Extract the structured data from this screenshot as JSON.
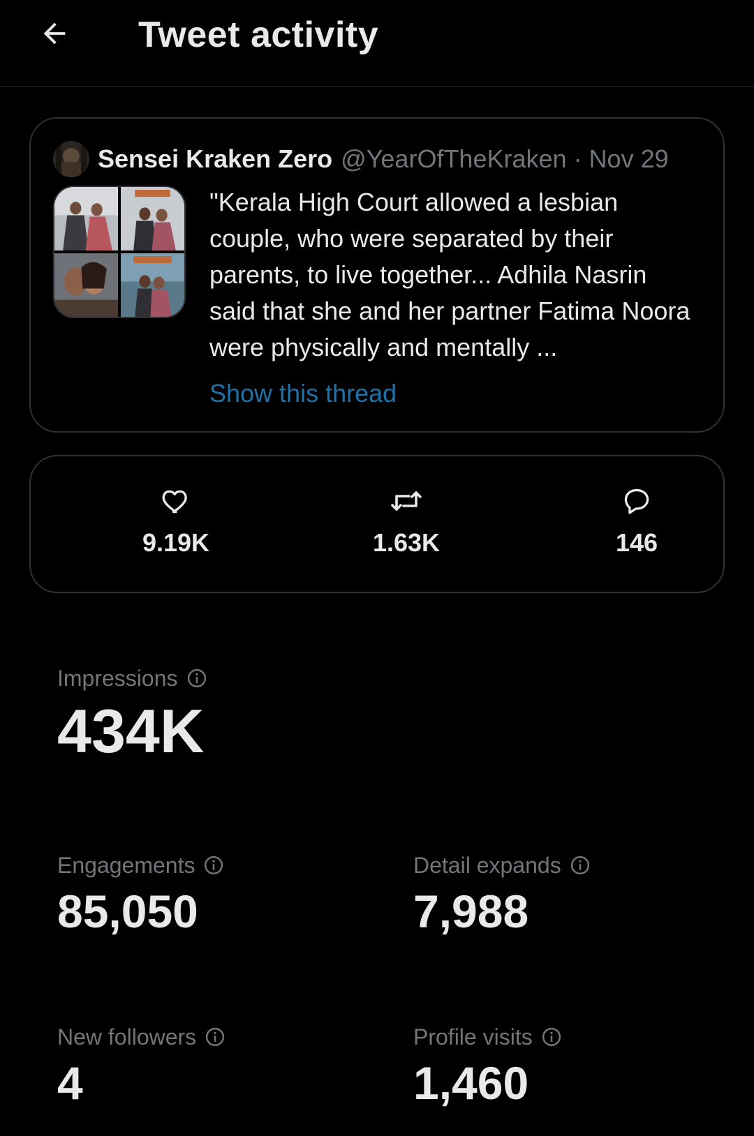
{
  "header": {
    "title": "Tweet activity",
    "back_icon": "arrow-left-icon"
  },
  "tweet": {
    "author_name": "Sensei Kraken Zero",
    "handle": "@YearOfTheKraken",
    "separator": "·",
    "date": "Nov 29",
    "text": "\"Kerala High Court allowed a lesbian couple, who were separated by their parents, to live together... Adhila Nasrin said that she and her partner Fatima Noora were physically and mentally ...",
    "show_thread_label": "Show this thread",
    "media_count": 4
  },
  "engagement": {
    "likes": "9.19K",
    "retweets": "1.63K",
    "replies": "146"
  },
  "metrics": {
    "impressions": {
      "label": "Impressions",
      "value": "434K"
    },
    "engagements": {
      "label": "Engagements",
      "value": "85,050"
    },
    "detail_expands": {
      "label": "Detail expands",
      "value": "7,988"
    },
    "new_followers": {
      "label": "New followers",
      "value": "4"
    },
    "profile_visits": {
      "label": "Profile visits",
      "value": "1,460"
    }
  },
  "colors": {
    "background": "#000000",
    "text_primary": "#e7e9ea",
    "text_secondary": "#71767b",
    "link": "#1d72aa",
    "border": "#2f3336"
  }
}
